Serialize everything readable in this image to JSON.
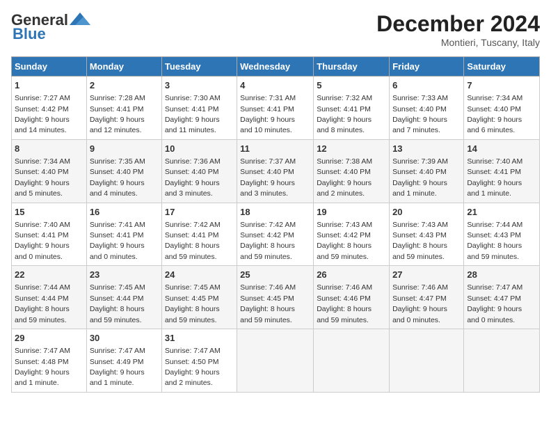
{
  "header": {
    "logo_line1": "General",
    "logo_line2": "Blue",
    "month": "December 2024",
    "location": "Montieri, Tuscany, Italy"
  },
  "days_of_week": [
    "Sunday",
    "Monday",
    "Tuesday",
    "Wednesday",
    "Thursday",
    "Friday",
    "Saturday"
  ],
  "weeks": [
    [
      {
        "day": "1",
        "info": "Sunrise: 7:27 AM\nSunset: 4:42 PM\nDaylight: 9 hours\nand 14 minutes."
      },
      {
        "day": "2",
        "info": "Sunrise: 7:28 AM\nSunset: 4:41 PM\nDaylight: 9 hours\nand 12 minutes."
      },
      {
        "day": "3",
        "info": "Sunrise: 7:30 AM\nSunset: 4:41 PM\nDaylight: 9 hours\nand 11 minutes."
      },
      {
        "day": "4",
        "info": "Sunrise: 7:31 AM\nSunset: 4:41 PM\nDaylight: 9 hours\nand 10 minutes."
      },
      {
        "day": "5",
        "info": "Sunrise: 7:32 AM\nSunset: 4:41 PM\nDaylight: 9 hours\nand 8 minutes."
      },
      {
        "day": "6",
        "info": "Sunrise: 7:33 AM\nSunset: 4:40 PM\nDaylight: 9 hours\nand 7 minutes."
      },
      {
        "day": "7",
        "info": "Sunrise: 7:34 AM\nSunset: 4:40 PM\nDaylight: 9 hours\nand 6 minutes."
      }
    ],
    [
      {
        "day": "8",
        "info": "Sunrise: 7:34 AM\nSunset: 4:40 PM\nDaylight: 9 hours\nand 5 minutes."
      },
      {
        "day": "9",
        "info": "Sunrise: 7:35 AM\nSunset: 4:40 PM\nDaylight: 9 hours\nand 4 minutes."
      },
      {
        "day": "10",
        "info": "Sunrise: 7:36 AM\nSunset: 4:40 PM\nDaylight: 9 hours\nand 3 minutes."
      },
      {
        "day": "11",
        "info": "Sunrise: 7:37 AM\nSunset: 4:40 PM\nDaylight: 9 hours\nand 3 minutes."
      },
      {
        "day": "12",
        "info": "Sunrise: 7:38 AM\nSunset: 4:40 PM\nDaylight: 9 hours\nand 2 minutes."
      },
      {
        "day": "13",
        "info": "Sunrise: 7:39 AM\nSunset: 4:40 PM\nDaylight: 9 hours\nand 1 minute."
      },
      {
        "day": "14",
        "info": "Sunrise: 7:40 AM\nSunset: 4:41 PM\nDaylight: 9 hours\nand 1 minute."
      }
    ],
    [
      {
        "day": "15",
        "info": "Sunrise: 7:40 AM\nSunset: 4:41 PM\nDaylight: 9 hours\nand 0 minutes."
      },
      {
        "day": "16",
        "info": "Sunrise: 7:41 AM\nSunset: 4:41 PM\nDaylight: 9 hours\nand 0 minutes."
      },
      {
        "day": "17",
        "info": "Sunrise: 7:42 AM\nSunset: 4:41 PM\nDaylight: 8 hours\nand 59 minutes."
      },
      {
        "day": "18",
        "info": "Sunrise: 7:42 AM\nSunset: 4:42 PM\nDaylight: 8 hours\nand 59 minutes."
      },
      {
        "day": "19",
        "info": "Sunrise: 7:43 AM\nSunset: 4:42 PM\nDaylight: 8 hours\nand 59 minutes."
      },
      {
        "day": "20",
        "info": "Sunrise: 7:43 AM\nSunset: 4:43 PM\nDaylight: 8 hours\nand 59 minutes."
      },
      {
        "day": "21",
        "info": "Sunrise: 7:44 AM\nSunset: 4:43 PM\nDaylight: 8 hours\nand 59 minutes."
      }
    ],
    [
      {
        "day": "22",
        "info": "Sunrise: 7:44 AM\nSunset: 4:44 PM\nDaylight: 8 hours\nand 59 minutes."
      },
      {
        "day": "23",
        "info": "Sunrise: 7:45 AM\nSunset: 4:44 PM\nDaylight: 8 hours\nand 59 minutes."
      },
      {
        "day": "24",
        "info": "Sunrise: 7:45 AM\nSunset: 4:45 PM\nDaylight: 8 hours\nand 59 minutes."
      },
      {
        "day": "25",
        "info": "Sunrise: 7:46 AM\nSunset: 4:45 PM\nDaylight: 8 hours\nand 59 minutes."
      },
      {
        "day": "26",
        "info": "Sunrise: 7:46 AM\nSunset: 4:46 PM\nDaylight: 8 hours\nand 59 minutes."
      },
      {
        "day": "27",
        "info": "Sunrise: 7:46 AM\nSunset: 4:47 PM\nDaylight: 9 hours\nand 0 minutes."
      },
      {
        "day": "28",
        "info": "Sunrise: 7:47 AM\nSunset: 4:47 PM\nDaylight: 9 hours\nand 0 minutes."
      }
    ],
    [
      {
        "day": "29",
        "info": "Sunrise: 7:47 AM\nSunset: 4:48 PM\nDaylight: 9 hours\nand 1 minute."
      },
      {
        "day": "30",
        "info": "Sunrise: 7:47 AM\nSunset: 4:49 PM\nDaylight: 9 hours\nand 1 minute."
      },
      {
        "day": "31",
        "info": "Sunrise: 7:47 AM\nSunset: 4:50 PM\nDaylight: 9 hours\nand 2 minutes."
      },
      null,
      null,
      null,
      null
    ]
  ]
}
